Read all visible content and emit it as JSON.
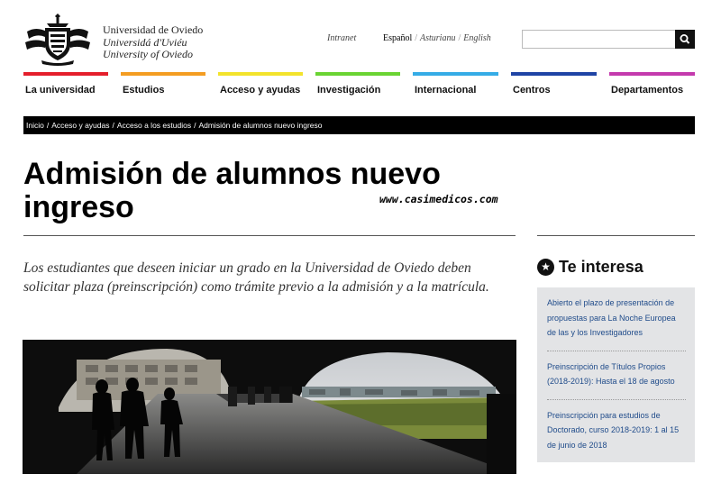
{
  "header": {
    "names": [
      "Universidad de Oviedo",
      "Universidá d'Uviéu",
      "University of Oviedo"
    ],
    "intranet": "Intranet",
    "languages": [
      {
        "label": "Español",
        "active": true
      },
      {
        "label": "Asturianu",
        "active": false
      },
      {
        "label": "English",
        "active": false
      }
    ],
    "search_placeholder": ""
  },
  "nav": [
    {
      "label": "La universidad",
      "color": "#e41f2c"
    },
    {
      "label": "Estudios",
      "color": "#f49d22"
    },
    {
      "label": "Acceso y ayudas",
      "color": "#f3e32c"
    },
    {
      "label": "Investigación",
      "color": "#6ad433"
    },
    {
      "label": "Internacional",
      "color": "#35ace6"
    },
    {
      "label": "Centros",
      "color": "#1f44a5"
    },
    {
      "label": "Departamentos",
      "color": "#c43aad"
    }
  ],
  "breadcrumb": [
    "Inicio",
    "Acceso y ayudas",
    "Acceso a los estudios",
    "Admisión de alumnos nuevo ingreso"
  ],
  "page": {
    "title": "Admisión de alumnos nuevo ingreso",
    "watermark": "www.casimedicos.com",
    "intro": "Los estudiantes que deseen iniciar un grado en la Universidad de Oviedo deben solicitar plaza (preinscripción) como trámite previo a la admisión y a la matrícula."
  },
  "sidebar": {
    "title": "Te interesa",
    "links": [
      "Abierto el plazo de presentación de propuestas para La Noche Europea de las y los Investigadores",
      "Preinscripción de Títulos Propios (2018-2019): Hasta el 18 de agosto",
      "Preinscripción para estudios de Doctorado, curso 2018-2019: 1 al 15 de junio de 2018"
    ]
  }
}
